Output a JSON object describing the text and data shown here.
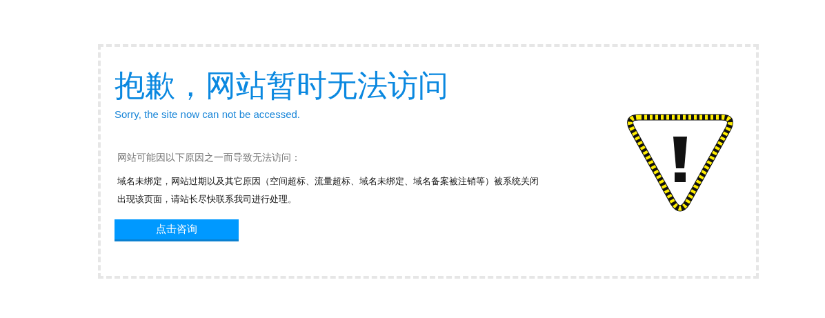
{
  "error_panel": {
    "title": "抱歉，网站暂时无法访问",
    "subtitle": "Sorry, the site now can not be accessed.",
    "reasons_heading": "网站可能因以下原因之一而导致无法访问：",
    "reasons_text": [
      "域名未绑定，网站过期以及其它原因（空间超标、流量超标、域名未绑定、域名备案被注销等）被系统关闭",
      "出现该页面，请站长尽快联系我司进行处理。"
    ],
    "button": "点击咨询"
  }
}
